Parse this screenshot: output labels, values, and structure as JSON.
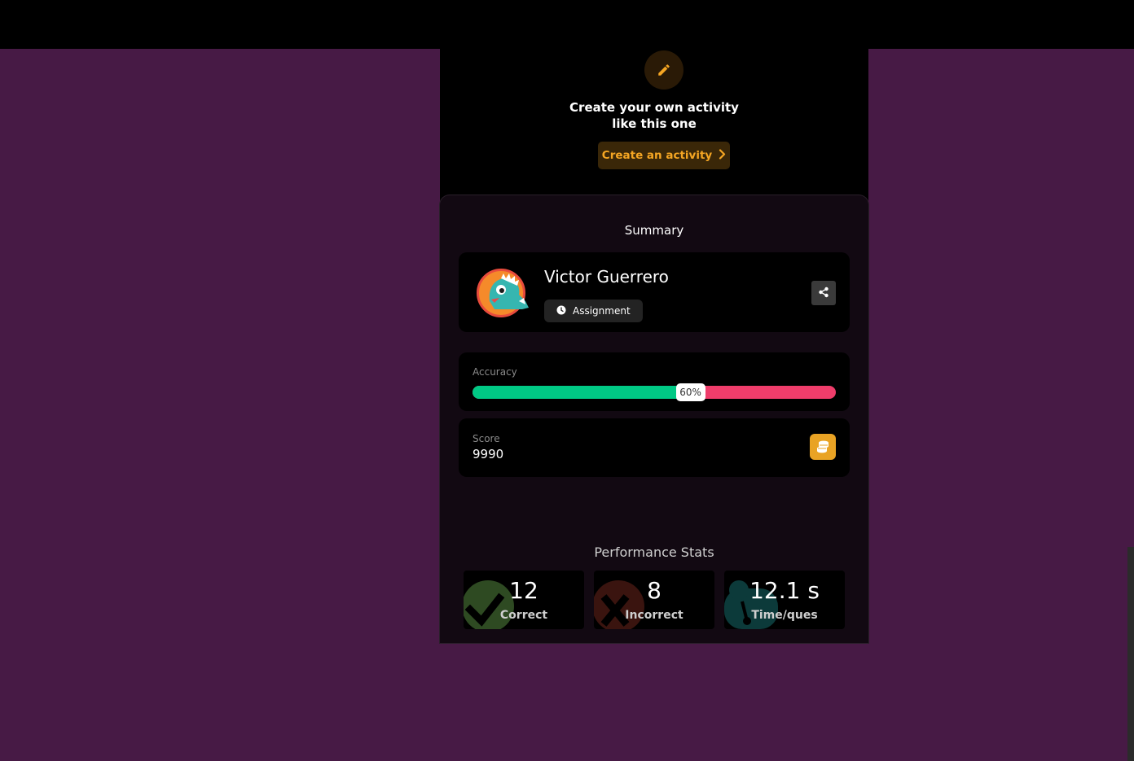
{
  "cta": {
    "line1": "Create your own activity",
    "line2": "like this one",
    "button_label": "Create an activity"
  },
  "summary": {
    "title": "Summary",
    "player": {
      "name": "Victor Guerrero",
      "mode_label": "Assignment"
    },
    "accuracy": {
      "label": "Accuracy",
      "percent": 60,
      "percent_label": "60%"
    },
    "score": {
      "label": "Score",
      "value": "9990"
    }
  },
  "performance": {
    "title": "Performance Stats",
    "stats": [
      {
        "value": "12",
        "label": "Correct",
        "icon": "check-icon"
      },
      {
        "value": "8",
        "label": "Incorrect",
        "icon": "cross-icon"
      },
      {
        "value": "12.1 s",
        "label": "Time/ques",
        "icon": "timer-icon"
      }
    ]
  },
  "colors": {
    "page_background": "#471a45",
    "accent_orange": "#f5a623",
    "accuracy_correct": "#00c985",
    "accuracy_incorrect": "#ef3d6b",
    "coin": "#e9a324"
  }
}
